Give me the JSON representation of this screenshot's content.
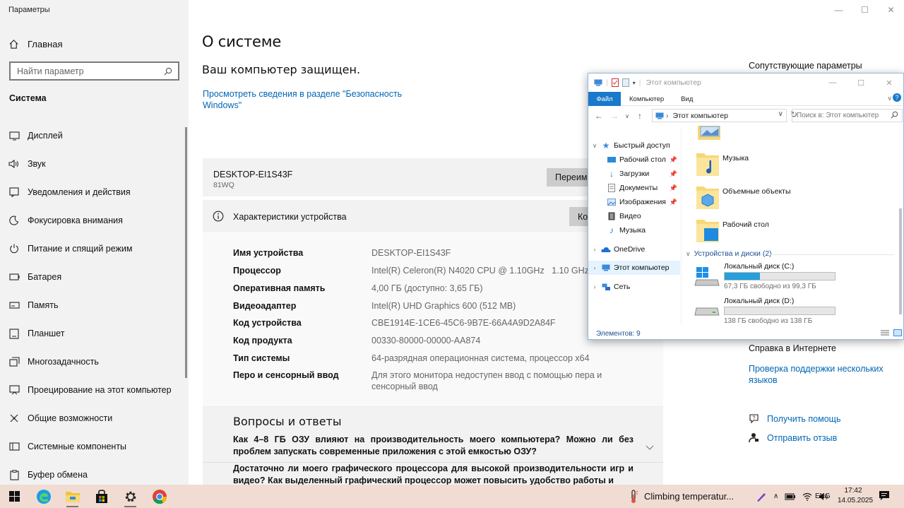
{
  "app": {
    "title": "Параметры",
    "window_controls": [
      "—",
      "☐",
      "✕"
    ]
  },
  "sidebar": {
    "home": "Главная",
    "search_placeholder": "Найти параметр",
    "section": "Система",
    "items": [
      {
        "label": "Дисплей",
        "icon": "display-icon"
      },
      {
        "label": "Звук",
        "icon": "sound-icon"
      },
      {
        "label": "Уведомления и действия",
        "icon": "notifications-icon"
      },
      {
        "label": "Фокусировка внимания",
        "icon": "focus-assist-icon"
      },
      {
        "label": "Питание и спящий режим",
        "icon": "power-icon"
      },
      {
        "label": "Батарея",
        "icon": "battery-icon"
      },
      {
        "label": "Память",
        "icon": "storage-icon"
      },
      {
        "label": "Планшет",
        "icon": "tablet-icon"
      },
      {
        "label": "Многозадачность",
        "icon": "multitasking-icon"
      },
      {
        "label": "Проецирование на этот компьютер",
        "icon": "projecting-icon"
      },
      {
        "label": "Общие возможности",
        "icon": "shared-experiences-icon"
      },
      {
        "label": "Системные компоненты",
        "icon": "system-components-icon"
      },
      {
        "label": "Буфер обмена",
        "icon": "clipboard-icon"
      }
    ]
  },
  "main": {
    "title": "О системе",
    "protected": "Ваш компьютер защищен.",
    "security_link": "Просмотреть сведения в разделе \"Безопасность Windows\"",
    "device_name": "DESKTOP-EI1S43F",
    "device_model": "81WQ",
    "rename_button": "Переименовать этот ПК",
    "spec_title": "Характеристики устройства",
    "copy_button": "Копировать",
    "specs": [
      {
        "key": "Имя устройства",
        "value": "DESKTOP-EI1S43F"
      },
      {
        "key": "Процессор",
        "value": "Intel(R) Celeron(R) N4020 CPU @ 1.10GHz   1.10 GHz"
      },
      {
        "key": "Оперативная память",
        "value": "4,00 ГБ (доступно: 3,65 ГБ)"
      },
      {
        "key": "Видеоадаптер",
        "value": "Intel(R) UHD Graphics 600 (512 MB)"
      },
      {
        "key": "Код устройства",
        "value": "CBE1914E-1CE6-45C6-9B7E-66A4A9D2A84F"
      },
      {
        "key": "Код продукта",
        "value": "00330-80000-00000-AA874"
      },
      {
        "key": "Тип системы",
        "value": "64-разрядная операционная система, процессор x64"
      },
      {
        "key": "Перо и сенсорный ввод",
        "value": "Для этого монитора недоступен ввод с помощью пера и сенсорный ввод"
      }
    ],
    "faq_title": "Вопросы и ответы",
    "faq": [
      "Как 4–8 ГБ ОЗУ влияют на производительность моего компьютера? Можно ли без проблем запускать современные приложения с этой емкостью ОЗУ?",
      "Достаточно ли моего графического процессора для высокой производительности игр и видео? Как выделенный графический процессор может повысить удобство работы и"
    ]
  },
  "related": {
    "title": "Сопутствующие параметры",
    "help_title": "Справка в Интернете",
    "help_link": "Проверка поддержки нескольких языков",
    "get_help": "Получить помощь",
    "feedback": "Отправить отзыв"
  },
  "explorer": {
    "title": "Этот компьютер",
    "ribbon": {
      "file": "Файл",
      "computer": "Компьютер",
      "view": "Вид"
    },
    "address": "Этот компьютер",
    "search_placeholder": "Поиск в: Этот компьютер",
    "tree": {
      "quick_access": "Быстрый доступ",
      "desktop": "Рабочий стол",
      "downloads": "Загрузки",
      "documents": "Документы",
      "pictures": "Изображения",
      "videos": "Видео",
      "music": "Музыка",
      "onedrive": "OneDrive",
      "this_pc": "Этот компьютер",
      "network": "Сеть"
    },
    "folders": [
      {
        "name": "Музыка"
      },
      {
        "name": "Объемные объекты"
      },
      {
        "name": "Рабочий стол"
      }
    ],
    "drives_group": "Устройства и диски (2)",
    "drives": [
      {
        "name": "Локальный диск (C:)",
        "free": "67,3 ГБ свободно из 99,3 ГБ",
        "used_fraction": 0.32
      },
      {
        "name": "Локальный диск (D:)",
        "free": "138 ГБ свободно из 138 ГБ",
        "used_fraction": 0.0
      }
    ],
    "status": "Элементов: 9"
  },
  "taskbar": {
    "weather": "Climbing temperatur...",
    "lang": "ENG",
    "time": "17:42",
    "date": "14.05.2025",
    "colors": {
      "bar": "#f0dcd3",
      "accent": "#0078d7"
    }
  }
}
